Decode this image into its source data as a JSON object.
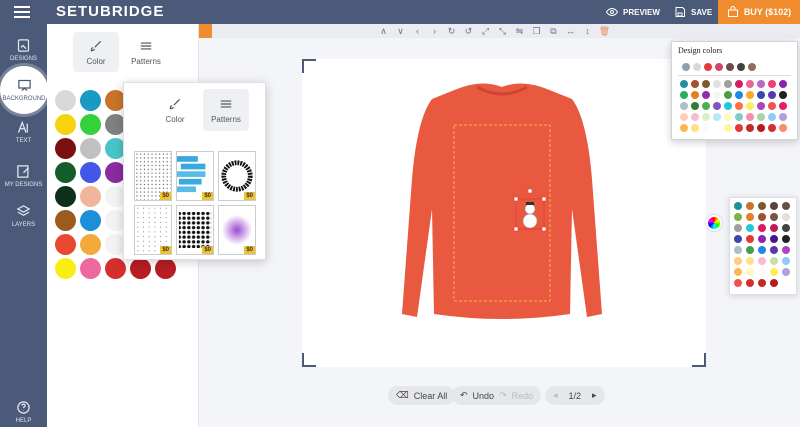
{
  "app": {
    "brand": "SETUBRIDGE"
  },
  "topbar": {
    "preview": "PREVIEW",
    "save": "SAVE",
    "buy": "BUY ($102)"
  },
  "sidebar": {
    "items": [
      {
        "label": "DESIGNS",
        "icon": "designs-icon"
      },
      {
        "label": "BACKGROUND",
        "icon": "easel-icon"
      },
      {
        "label": "TEXT",
        "icon": "text-icon"
      },
      {
        "label": "MY DESIGNS",
        "icon": "edit-icon"
      },
      {
        "label": "LAYERS",
        "icon": "layers-icon"
      }
    ],
    "help": "HELP"
  },
  "panel": {
    "tabs": [
      "Color",
      "Patterns"
    ],
    "swatches": [
      "#d9d9d9",
      "#1a99c4",
      "#c8732c",
      "#f3f3f3",
      "#f3f3f3",
      "#f7d30f",
      "#33d13b",
      "#808080",
      "#f3f3f3",
      "#f3f3f3",
      "#7a1010",
      "#c0c0c0",
      "#48c5c8",
      "#f3f3f3",
      "#f3f3f3",
      "#145c2a",
      "#4257e8",
      "#8a2ba0",
      "#f3f3f3",
      "#f3f3f3",
      "#0e2f18",
      "#f0b59a",
      "#f3f3f3",
      "#f3f3f3",
      "#f3f3f3",
      "#9c5a1c",
      "#1c8fd9",
      "#f3f3f3",
      "#f3f3f3",
      "#f3f3f3",
      "#e8492e",
      "#f4a93d",
      "#f3f3f3",
      "#f3f3f3",
      "#f3f3f3",
      "#f9ee12",
      "#ec6aa0",
      "#d52e2e",
      "#b81d22",
      "#b81d22"
    ]
  },
  "patterns_popup": {
    "tabs": [
      "Color",
      "Patterns"
    ],
    "items": [
      {
        "name": "pattern-dots-grid",
        "price": "$0"
      },
      {
        "name": "pattern-blue-strokes",
        "price": "$0"
      },
      {
        "name": "pattern-ring",
        "price": "$0"
      },
      {
        "name": "pattern-sparse-dots",
        "price": "$0"
      },
      {
        "name": "pattern-black-dots",
        "price": "$0"
      },
      {
        "name": "pattern-halftone",
        "price": "$0"
      }
    ]
  },
  "design_colors": {
    "title": "Design colors",
    "top_row": [
      "#8aa0b8",
      "#d9d9d9",
      "#e53935",
      "#d4426c",
      "#6d4c41",
      "#424242",
      "#8d6e63"
    ],
    "palette": [
      "#1f8f9e",
      "#a0522d",
      "#7d5a2c",
      "#e0e0e0",
      "#9e9e9e",
      "#d81b60",
      "#f06292",
      "#ba68c8",
      "#ec407a",
      "#8e24aa",
      "#27ae60",
      "#e67e22",
      "#9c27b0",
      "#f5f5f5",
      "#43a047",
      "#1e88e5",
      "#f9a825",
      "#3949ab",
      "#5e35b1",
      "#212121",
      "#b0bec5",
      "#2e7d32",
      "#4caf50",
      "#7e57c2",
      "#26c6da",
      "#ff7043",
      "#ffee58",
      "#ab47bc",
      "#ef5350",
      "#e91e63",
      "#ffccbc",
      "#f8bbd0",
      "#dcedc8",
      "#b2ebf2",
      "#fff9c4",
      "#80cbc4",
      "#f48fb1",
      "#a5d6a7",
      "#90caf9",
      "#b39ddb",
      "#ffb74d",
      "#ffe082",
      "#fafafa",
      "#ffffff",
      "#fff59d",
      "#e53935",
      "#c62828",
      "#b71c1c",
      "#d32f2f",
      "#ff8a65"
    ]
  },
  "side_palette": {
    "colors": [
      "#1f8f9e",
      "#c8732c",
      "#7d5a2c",
      "#5d4037",
      "#6d4c41",
      "#7cb342",
      "#e67e22",
      "#a0522d",
      "#795548",
      "#e0e0e0",
      "#9e9e9e",
      "#26c6da",
      "#d81b60",
      "#c2185b",
      "#424242",
      "#3949ab",
      "#e53935",
      "#8e24aa",
      "#4a148c",
      "#212121",
      "#b0bec5",
      "#43a047",
      "#1e88e5",
      "#5e35b1",
      "#ab47bc",
      "#ffcc80",
      "#ffe082",
      "#f8bbd0",
      "#c5e1a5",
      "#90caf9",
      "#ffb74d",
      "#fff9c4",
      "#fafafa",
      "#ffee58",
      "#b39ddb",
      "#ef5350",
      "#d32f2f",
      "#c62828",
      "#b71c1c"
    ]
  },
  "bottom": {
    "clear_all": "Clear All",
    "undo": "Undo",
    "redo": "Redo",
    "page": "1/2"
  },
  "colors": {
    "shirt": "#e8593f",
    "sidebar": "#4b5a78",
    "accent": "#ee8c2e"
  }
}
